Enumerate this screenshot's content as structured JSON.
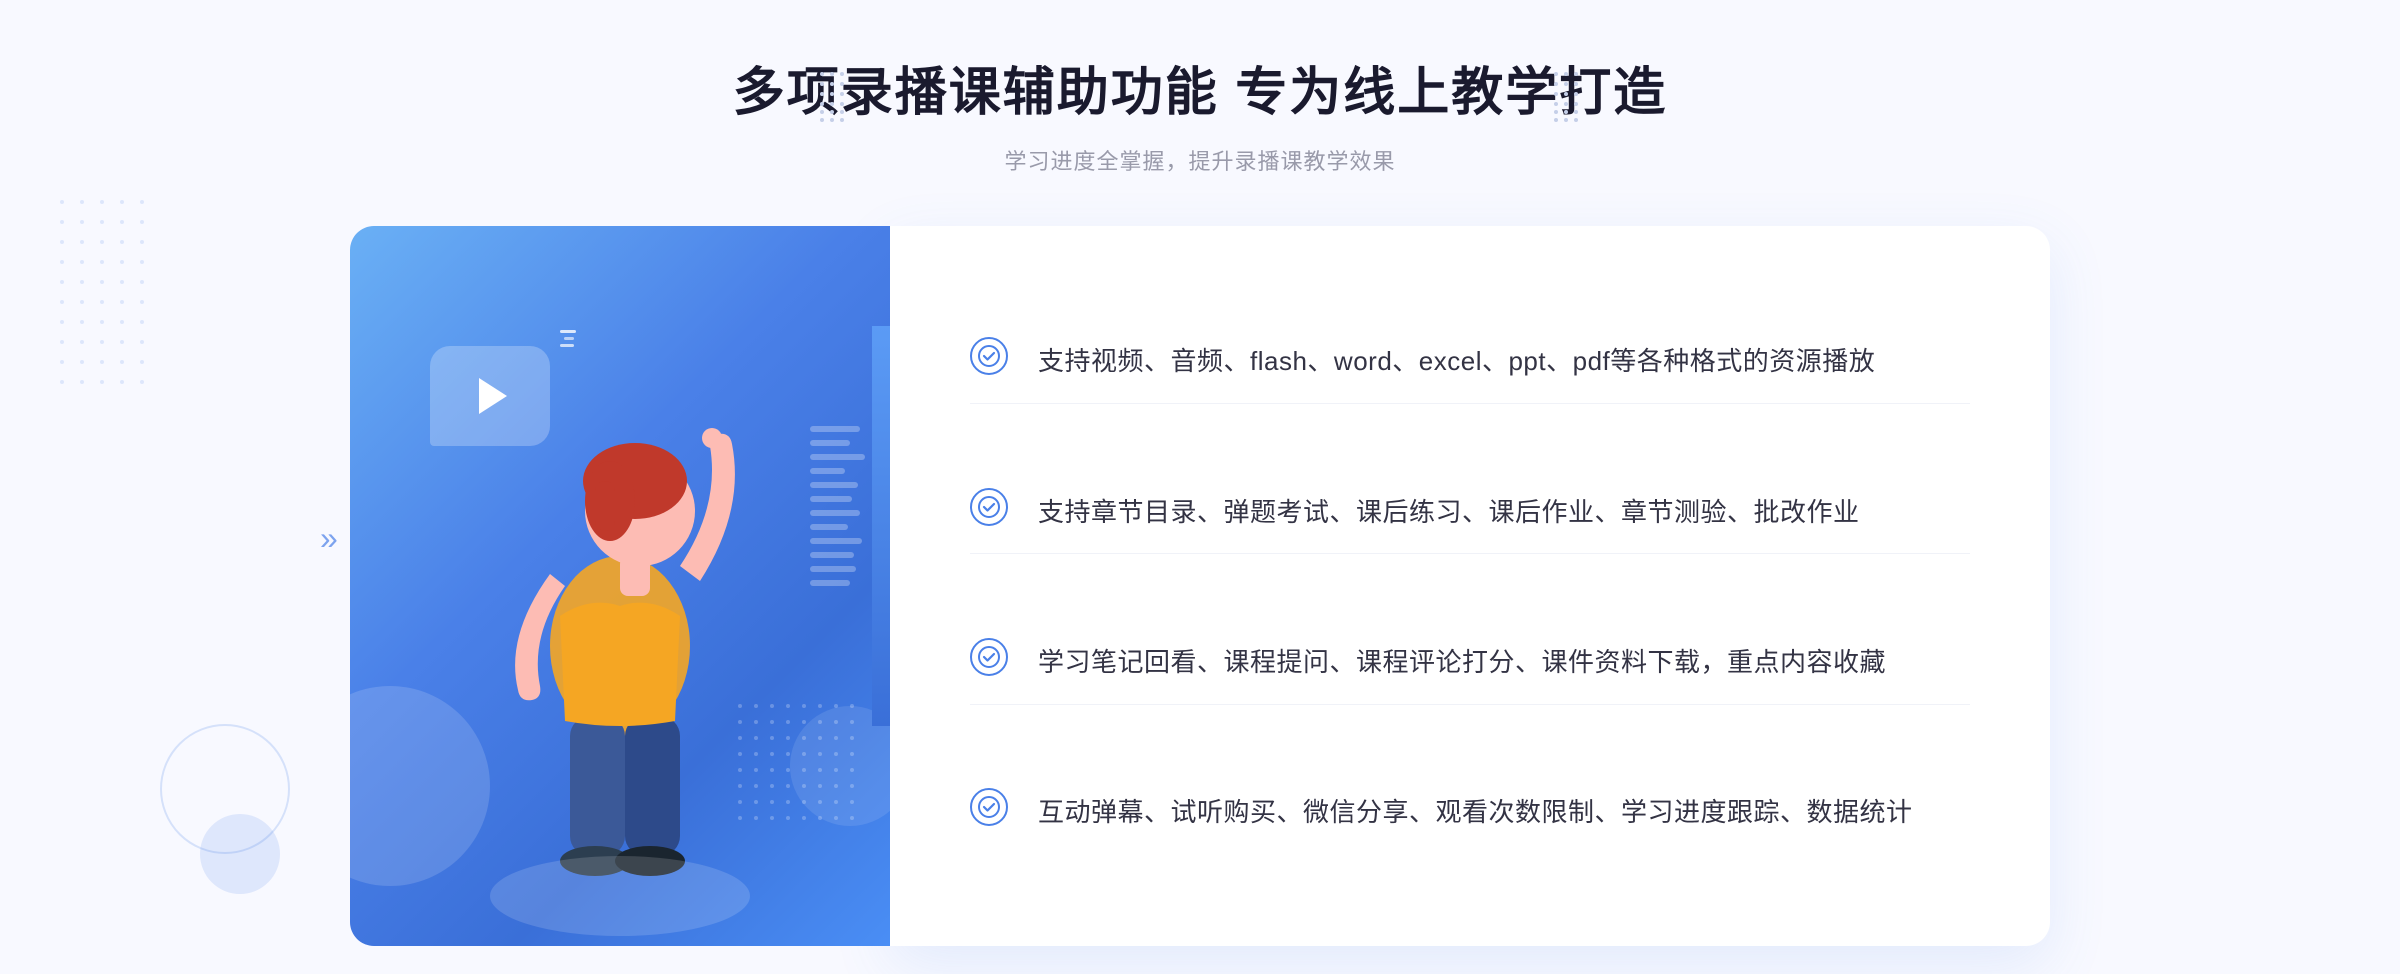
{
  "header": {
    "title": "多项录播课辅助功能 专为线上教学打造",
    "subtitle": "学习进度全掌握，提升录播课教学效果"
  },
  "features": [
    {
      "id": "feature-1",
      "text": "支持视频、音频、flash、word、excel、ppt、pdf等各种格式的资源播放"
    },
    {
      "id": "feature-2",
      "text": "支持章节目录、弹题考试、课后练习、课后作业、章节测验、批改作业"
    },
    {
      "id": "feature-3",
      "text": "学习笔记回看、课程提问、课程评论打分、课件资料下载，重点内容收藏"
    },
    {
      "id": "feature-4",
      "text": "互动弹幕、试听购买、微信分享、观看次数限制、学习进度跟踪、数据统计"
    }
  ],
  "icons": {
    "check": "✓",
    "play": "▶",
    "chevrons": "»"
  },
  "colors": {
    "primary": "#4a80e8",
    "primaryLight": "#6ab0f5",
    "text": "#333344",
    "subtext": "#999aaa",
    "white": "#ffffff",
    "bgLight": "#f8f9ff"
  }
}
